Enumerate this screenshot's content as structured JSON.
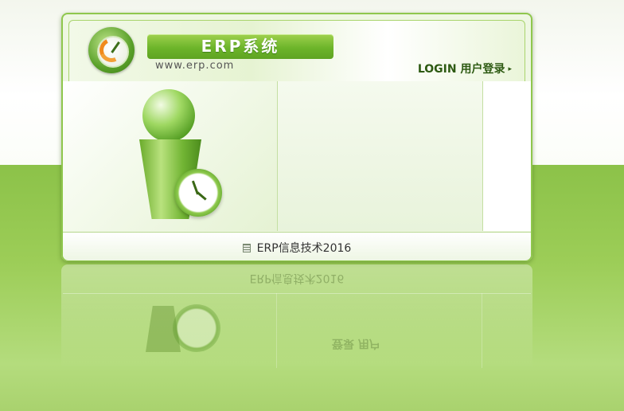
{
  "header": {
    "app_title": "ERP系统",
    "site_url": "www.erp.com",
    "login_label": "LOGIN 用户登录",
    "login_arrow": "▸"
  },
  "footer": {
    "text": "ERP信息技术2016",
    "icon": "document-icon"
  },
  "reflection": {
    "text": "ERP信息技术2016",
    "login_text": "登录 用户"
  },
  "colors": {
    "accent_green": "#6db52a",
    "background_green": "#9ccd57"
  }
}
